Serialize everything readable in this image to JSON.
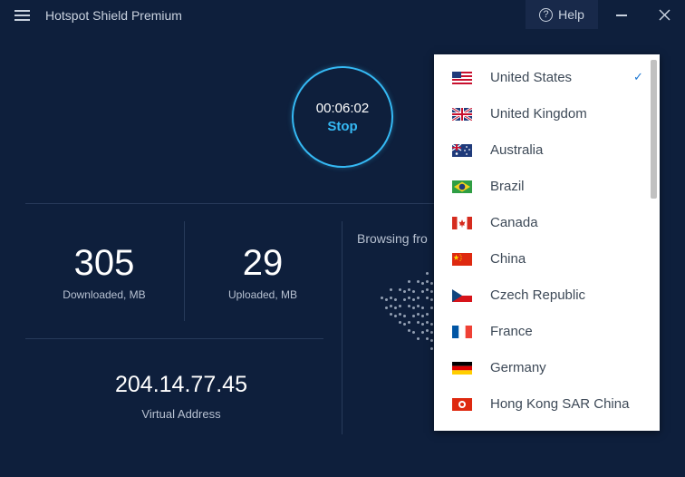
{
  "app": {
    "title": "Hotspot Shield Premium"
  },
  "titlebar": {
    "help_label": "Help",
    "help_glyph": "?"
  },
  "timer": {
    "time": "00:06:02",
    "stop_label": "Stop"
  },
  "stats": {
    "downloaded": {
      "value": "305",
      "label": "Downloaded, MB"
    },
    "uploaded": {
      "value": "29",
      "label": "Uploaded, MB"
    },
    "ip": {
      "value": "204.14.77.45",
      "label": "Virtual Address"
    }
  },
  "browsing": {
    "label": "Browsing fro"
  },
  "dropdown": {
    "selected": "United States",
    "check_glyph": "✓",
    "countries": [
      {
        "name": "United States",
        "flag": "us-flag-icon"
      },
      {
        "name": "United Kingdom",
        "flag": "uk-flag-icon"
      },
      {
        "name": "Australia",
        "flag": "australia-flag-icon"
      },
      {
        "name": "Brazil",
        "flag": "brazil-flag-icon"
      },
      {
        "name": "Canada",
        "flag": "canada-flag-icon"
      },
      {
        "name": "China",
        "flag": "china-flag-icon"
      },
      {
        "name": "Czech Republic",
        "flag": "czech-flag-icon"
      },
      {
        "name": "France",
        "flag": "france-flag-icon"
      },
      {
        "name": "Germany",
        "flag": "germany-flag-icon"
      },
      {
        "name": "Hong Kong SAR China",
        "flag": "hong-kong-flag-icon"
      }
    ]
  },
  "colors": {
    "background": "#0e1f3c",
    "accent": "#35b9f4",
    "check": "#1a76d2"
  }
}
